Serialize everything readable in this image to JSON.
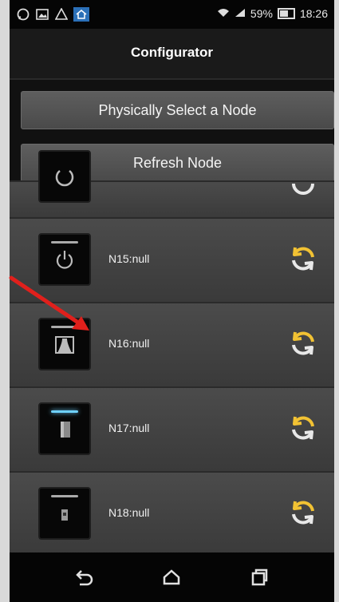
{
  "status_bar": {
    "left_icons": [
      "whatsapp-icon",
      "image-icon",
      "notification-icon",
      "home-icon"
    ],
    "right": {
      "wifi": "wifi-icon",
      "signal": "signal-icon",
      "battery_pct": "59%",
      "time": "18:26"
    }
  },
  "app_bar": {
    "title": "Configurator"
  },
  "actions": {
    "select_node": "Physically Select a Node",
    "refresh_node": "Refresh Node"
  },
  "nodes": [
    {
      "label": "",
      "icon": "power-icon"
    },
    {
      "label": "N15:null",
      "icon": "power-icon"
    },
    {
      "label": "N16:null",
      "icon": "curtain-icon"
    },
    {
      "label": "N17:null",
      "icon": "device-icon"
    },
    {
      "label": "N18:null",
      "icon": "plug-icon"
    }
  ],
  "colors": {
    "sync_accent": "#f2c233",
    "sync_secondary": "#e8e8e8",
    "annotation_arrow": "#e0201c"
  },
  "nav_bar": {
    "buttons": [
      "back-icon",
      "home-icon",
      "recents-icon"
    ]
  }
}
